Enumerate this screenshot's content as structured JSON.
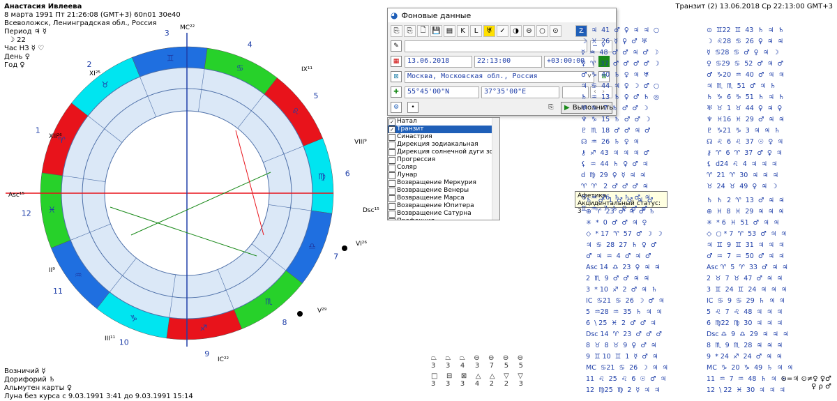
{
  "header": {
    "name": "Анастасия Ивлеева",
    "date_line": "8 марта 1991  Пт  21:26:08 (GMT+3) 60n01  30e40",
    "place": "Всеволожск, Ленинградская обл., Россия",
    "period_label": "Период",
    "period_value": "♃ ☿",
    "period_sub": "☽ 22",
    "hour_label": "Час НЗ ☿ ♡",
    "day_label": "День ♀",
    "year_label": "Год ♀"
  },
  "transit_header": "Транзит (2) 13.06.2018  Ср 22:13:00 GMT+3",
  "bottom_info": {
    "vozn": "Возничий ☿",
    "dorif": "Дорифорий ♄",
    "almuten": "Альмутен карты ♀",
    "moon": "Луна без курса с 9.03.1991  3:41 до 9.03.1991 15:14"
  },
  "dialog": {
    "title": "Фоновые данные",
    "date": "13.06.2018",
    "time": "22:13:00",
    "tz": "+03:00:00",
    "city": "Москва, Московская обл., Россия",
    "lat": "55°45'00\"N",
    "lon": "37°35'00\"E",
    "run_label": "Выполнить",
    "toolbar": [
      "⎘",
      "⎘",
      "🗋",
      "💾",
      "▤",
      "K",
      "L",
      "♅",
      "✓",
      "◑",
      "⊖",
      "○",
      "⊙",
      "Z"
    ]
  },
  "chart_types": [
    {
      "label": "Натал",
      "checked": true
    },
    {
      "label": "Транзит",
      "checked": true
    },
    {
      "label": "Синастрия",
      "checked": false
    },
    {
      "label": "Дирекция зодиакальная",
      "checked": false
    },
    {
      "label": "Дирекция солнечной дуги зодиак",
      "checked": false
    },
    {
      "label": "Прогрессия",
      "checked": false
    },
    {
      "label": "Соляр",
      "checked": false
    },
    {
      "label": "Лунар",
      "checked": false
    },
    {
      "label": "Возвращение Меркурия",
      "checked": false
    },
    {
      "label": "Возвращение Венеры",
      "checked": false
    },
    {
      "label": "Возвращение Марса",
      "checked": false
    },
    {
      "label": "Возвращение Юпитера",
      "checked": false
    },
    {
      "label": "Возвращение Сатурна",
      "checked": false
    },
    {
      "label": "Профекция",
      "checked": false
    }
  ],
  "tooltip": {
    "line1": "Афетика",
    "line2": "Акцидентальный статус: 3"
  },
  "wheel": {
    "house_numbers": [
      "1",
      "2",
      "3",
      "4",
      "5",
      "6",
      "7",
      "8",
      "9",
      "10",
      "11",
      "12"
    ],
    "cusp_labels": [
      "Asc¹⁵",
      "Dsc¹⁵",
      "MC²²",
      "IC²²",
      "XII²⁶",
      "XI²⁵",
      "IX¹¹",
      "VIII⁹",
      "II⁹",
      "III¹¹",
      "V²⁹",
      "VI²⁶"
    ],
    "sign_glyphs": [
      "♈",
      "♉",
      "♊",
      "♋",
      "♌",
      "♍",
      "♎",
      "♏",
      "♐",
      "♑",
      "♒",
      "♓"
    ]
  },
  "table_top": [
    "♄  ♃  41  ♂  ♀  ♃  ♃  ○",
    "☽  ♓  26  ☿  ♀  ♂  ♅",
    "☿  ♒  48  ♂  ♂  ♃  ♂  ☽",
    "♀  ♈  37  ♂  ♂  ♂  ♂  ☽",
    "♂  ♑  40  ♄  ♀  ♃  ♅",
    "♃  ♋  44  ♃  ♀  ☽  ♂  ○",
    "♄  ♒  13  ♄  ♀  ♂  ♄  ◎",
    "♅  ♑   7  ♄  ♂  ♂  ☽",
    "♆  ♑  15  ♄  ♂  ♂  ☽",
    "♇  ♏  18  ♂  ♂  ♃  ♂",
    "☊  ♒  26  ♄  ♀  ♃",
    "⚷  ♐  43  ♃  ♃  ♃  ♂",
    "⚸  ♒  44  ♄  ♀  ♂  ♃",
    "d  ♍  29  ♀  ☿  ♃  ♃",
    "♈  ♈   2  ♂  ♂  ♂  ♃",
    "♉  ♒  26  ♄  ♄  ♂  ♃",
    "♊  ♒   7  ♄  ♀  ♂  ♂"
  ],
  "table_top_r": [
    "⊙  ♊22  ♊  43  ♄  ♃  ♄",
    "☽  ♌28  ♋  26  ♀  ♃  ♃",
    "☿  ♋28  ♋  ♂  ♀  ♃  ☽",
    "♀  ♋29  ♋  52  ♂  ♃  ♂",
    "♂  ♑20  ♒  40  ♂  ♃  ♃",
    "♃  ♏  ♏  51  ♂  ♃  ♄",
    "♄  ♑  6  ♑  51  ♄  ♃  ♄",
    "♅  ♉  1  ♉  44  ♀  ♃  ♀",
    "♆  ♓16  ♓  29  ♂  ♃  ♃",
    "♇  ♑21  ♑  3  ♃  ♃  ♄",
    "☊  ♌  6  ♌  37  ☉  ♀  ♃",
    "⚷  ♈  6  ♈  37  ♂  ♀  ♃",
    "⚸  d24  ♌  4  ♃  ♃  ♃",
    "♈  21  ♈  30  ♃  ♃  ♃",
    "♉  24  ♉  49  ♀  ♃  ☽"
  ],
  "table_bottom": [
    "♄   ♂  1  ♂  ♂  ♃  ♂",
    "⊕  ♈  23  ♂  ♃  ♂  ♄",
    "✳  *  0  ♂  ♂  ♃  ♀",
    "◇  * 17  ♈  57  ♂  ☽  ☽",
    "♃  ♋  28  27  ♄  ♀  ♂",
    "♂  ♃  ♒  4  ♂  ♃  ♂",
    "Asc 14  ♎  23  ♀  ♃  ♃",
    "2  ♏  9  ♂  ♂  ♃  ♃",
    "3  * 10  ♐  2  ♂  ♃  ♄",
    "IC  ♋21  ♋  26  ☽  ♂  ♃",
    "5  ♒28  ♒  35  ♄  ♃  ♃",
    "6  \\ 25  ♓  2  ♂  ♂  ♃",
    "Dsc 14  ♈  23  ♂  ♂  ♂",
    "8  ♉  8  ♉  9  ♀  ♂  ♃",
    "9  ♊ 10  ♊  1  ☿  ♂  ♃",
    "MC  ♋21  ♋  26  ☽  ♃  ♃",
    "11  ♌  25  ♌  6  ☉  ♂  ♃",
    "12  ♍25  ♍  2  ☿  ♃  ♃"
  ],
  "table_bottom_r": [
    "♄  ♄  2  ♈  13  ♂  ♃  ♃",
    "⊕  ♓  8  ♓  29  ♃  ♃  ♃",
    "✳  * 6  ♓  51  ♂  ♃  ♃",
    "◇  ○ * 7  ♈  53  ♂  ♃  ♃",
    "♃  ♊  9  ♊  31  ♃  ♃  ♃",
    "♂  ♒  7  ♒  50  ♂  ♃  ♃",
    "Asc ♈  5  ♈  33  ♂  ♃  ♃",
    "2  ♉  7  ♉  47  ♂  ♃  ♃",
    "3  ♊  24  ♊  24  ♃  ♃  ♃",
    "IC  ♋  9  ♋  29  ♄  ♃  ♃",
    "5  ♌  7  ♌  48  ♃  ♃  ♃",
    "6  ♍22  ♍  30  ♃  ♃  ♃",
    "Dsc ♎  9  ♎  29  ♃  ♃  ♃",
    "8  ♏  9  ♏  28  ♃  ♃  ♃",
    "9  * 24  ♐  24  ♂  ♃  ♃",
    "MC  ♑  20  ♑  49  ♄  ♃  ♃",
    "11  ♒  7  ♒  48  ♄  ♃  ♄",
    "12  \\ 22  ♓  30  ♃  ♃  ♃"
  ],
  "aspects": {
    "row1_glyphs": [
      "⏢",
      "⏢",
      "⏢",
      "⊖",
      "⊖",
      "⊖",
      "⊖"
    ],
    "row1_nums": [
      "3",
      "3",
      "4",
      "3",
      "7",
      "5",
      "5"
    ],
    "row2_glyphs": [
      "□",
      "⊟",
      "⊠",
      "△",
      "△",
      "▽",
      "▽"
    ],
    "row2_nums": [
      "3",
      "3",
      "3",
      "4",
      "2",
      "2",
      "3"
    ]
  },
  "bottom_right": {
    "line1": "⊙=♃ ⊙≠♀ ♀♂",
    "line2": "♀ ρ ♂"
  }
}
